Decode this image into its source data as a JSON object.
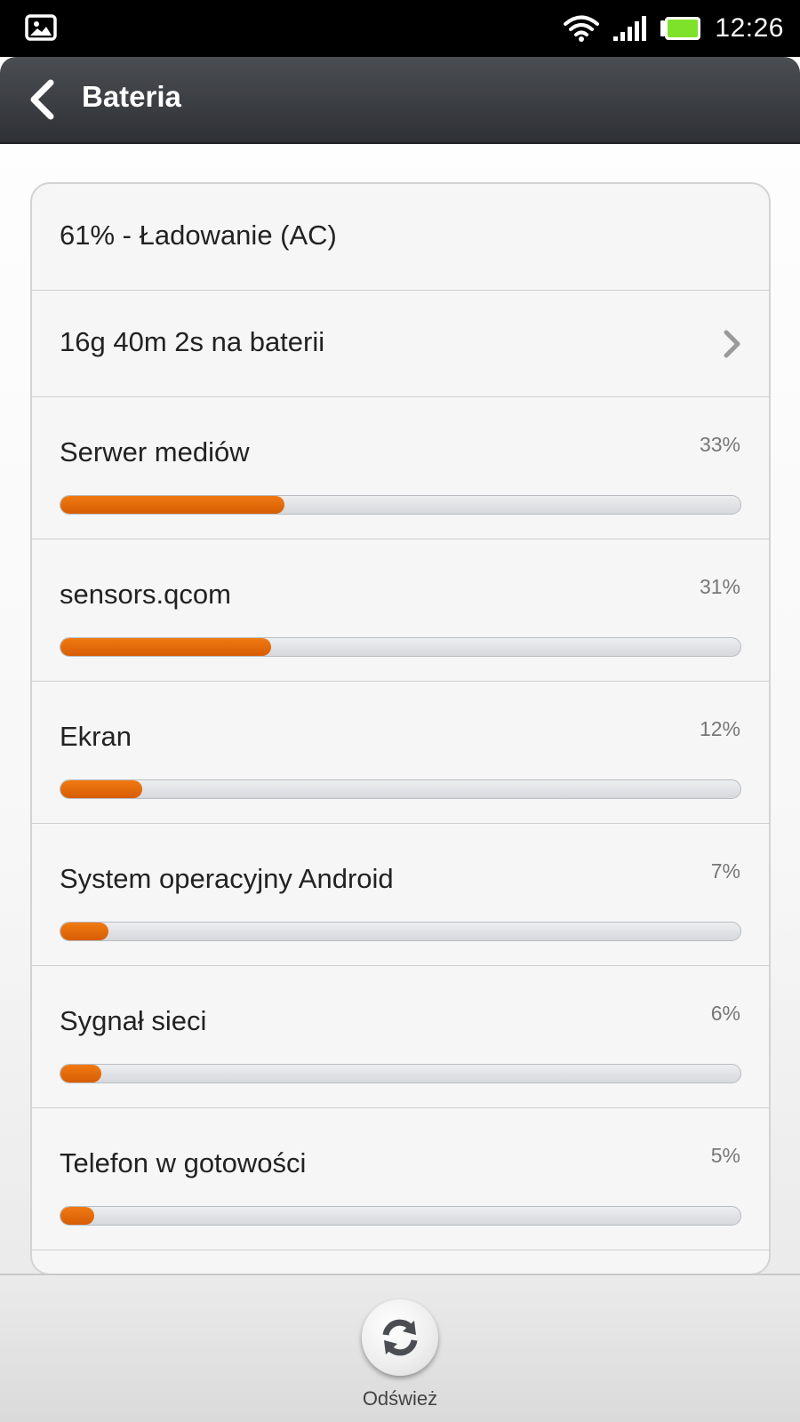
{
  "status_bar": {
    "time": "12:26",
    "icons": [
      "image-notification-icon",
      "wifi-icon",
      "signal-icon",
      "battery-charging-icon"
    ],
    "battery_color": "#7ee22b"
  },
  "title_bar": {
    "title": "Bateria",
    "back_icon": "back-arrow-icon"
  },
  "summary": {
    "status": "61% - Ładowanie (AC)",
    "on_battery": "16g 40m 2s na baterii",
    "chevron_icon": "chevron-right-icon"
  },
  "usage": [
    {
      "name": "Serwer mediów",
      "percent_label": "33%",
      "percent": 33
    },
    {
      "name": "sensors.qcom",
      "percent_label": "31%",
      "percent": 31
    },
    {
      "name": "Ekran",
      "percent_label": "12%",
      "percent": 12
    },
    {
      "name": "System operacyjny Android",
      "percent_label": "7%",
      "percent": 7
    },
    {
      "name": "Sygnał sieci",
      "percent_label": "6%",
      "percent": 6
    },
    {
      "name": "Telefon w gotowości",
      "percent_label": "5%",
      "percent": 5
    }
  ],
  "bottom_bar": {
    "refresh_label": "Odśwież",
    "refresh_icon": "refresh-icon"
  },
  "colors": {
    "bar_fill": "#e36a08",
    "bar_track": "#dfe1e4"
  }
}
